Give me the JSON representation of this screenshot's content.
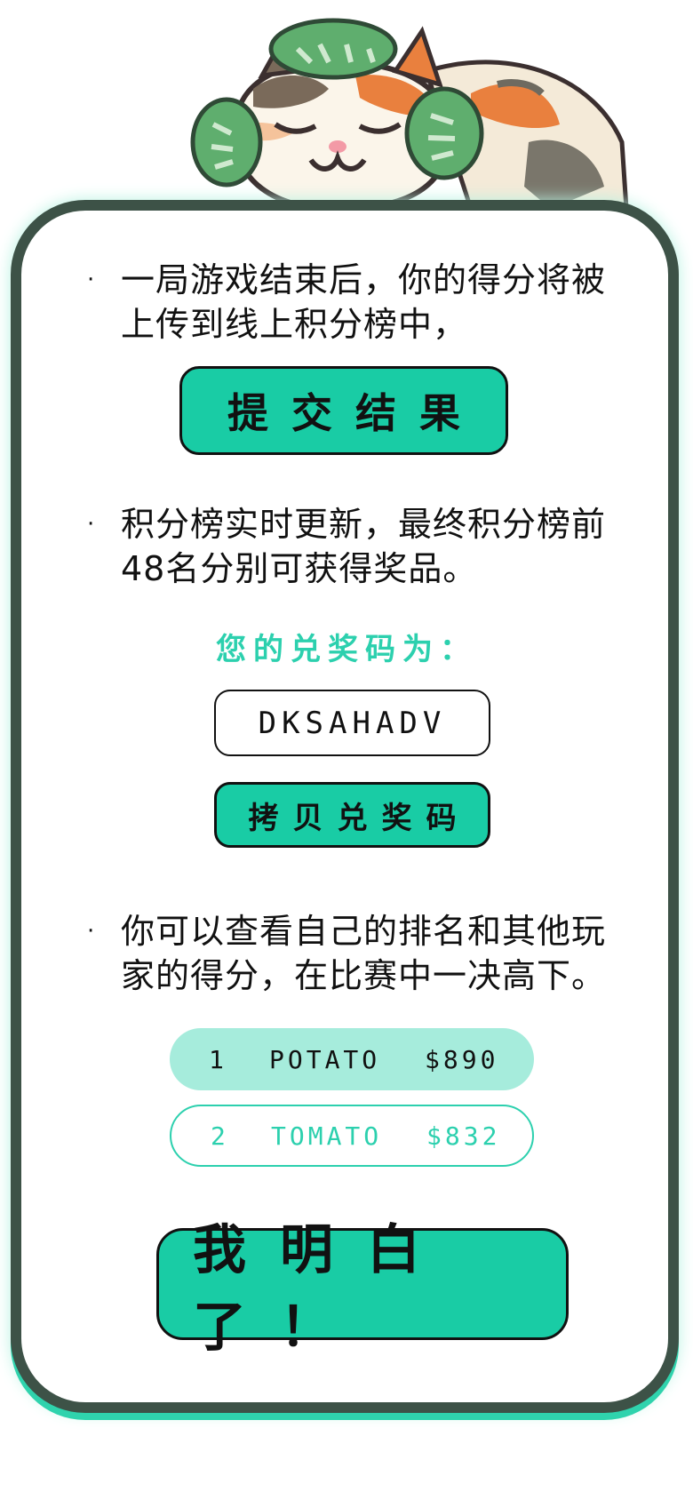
{
  "intro": {
    "bullet": "·",
    "text": "一局游戏结束后，你的得分将被上传到线上积分榜中，"
  },
  "submit_button": {
    "label": "提交结果"
  },
  "leaderboard_info": {
    "bullet": "·",
    "text": "积分榜实时更新，最终积分榜前48名分别可获得奖品。"
  },
  "redeem": {
    "label": "您的兑奖码为：",
    "code": "DKSAHADV",
    "copy_label": "拷贝兑奖码"
  },
  "ranking_info": {
    "bullet": "·",
    "text": "你可以查看自己的排名和其他玩家的得分，在比赛中一决高下。"
  },
  "rankings": [
    {
      "rank": "1",
      "name": "POTATO",
      "score": "$890"
    },
    {
      "rank": "2",
      "name": "TOMATO",
      "score": "$832"
    }
  ],
  "ok_button": {
    "label": "我明白了！"
  },
  "colors": {
    "accent": "#19cca5",
    "accent_text": "#2cd0ae",
    "border": "#3d5247",
    "highlight_row": "#a6ecdc"
  },
  "icons": {
    "mascot": "calico-cat-with-leaf-hat"
  }
}
